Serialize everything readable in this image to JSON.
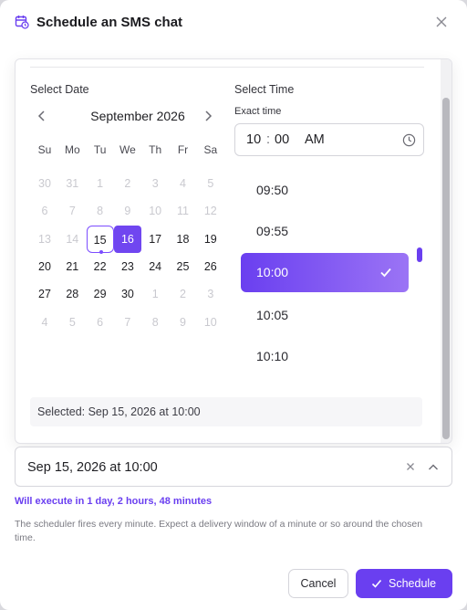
{
  "dialog": {
    "title": "Schedule an SMS chat",
    "title_icon": "calendar-clock-icon",
    "close_icon": "close-icon"
  },
  "calendar": {
    "label": "Select Date",
    "month": "September 2026",
    "weekdays": [
      "Su",
      "Mo",
      "Tu",
      "We",
      "Th",
      "Fr",
      "Sa"
    ],
    "weeks": [
      [
        "30",
        "31",
        "1",
        "2",
        "3",
        "4",
        "5"
      ],
      [
        "6",
        "7",
        "8",
        "9",
        "10",
        "11",
        "12"
      ],
      [
        "13",
        "14",
        "15",
        "16",
        "17",
        "18",
        "19"
      ],
      [
        "20",
        "21",
        "22",
        "23",
        "24",
        "25",
        "26"
      ],
      [
        "27",
        "28",
        "29",
        "30",
        "1",
        "2",
        "3"
      ],
      [
        "4",
        "5",
        "6",
        "7",
        "8",
        "9",
        "10"
      ]
    ],
    "today": "15",
    "selected": "16"
  },
  "time": {
    "label": "Select Time",
    "exact_label": "Exact time",
    "hour": "10",
    "separator": ":",
    "minute": "00",
    "meridiem": "AM",
    "slots": [
      "09:50",
      "09:55",
      "10:00",
      "10:05",
      "10:10"
    ],
    "active_slot": "10:00"
  },
  "selected_summary": "Selected: Sep 15, 2026 at 10:00",
  "field": {
    "value": "Sep 15, 2026 at 10:00"
  },
  "execute_text": "Will execute in 1 day, 2 hours, 48 minutes",
  "note": "The scheduler fires every minute. Expect a delivery window of a minute or so around the chosen time.",
  "buttons": {
    "cancel": "Cancel",
    "schedule": "Schedule"
  },
  "colors": {
    "accent": "#6a3ff0",
    "muted_day": "#c9c9cf"
  }
}
